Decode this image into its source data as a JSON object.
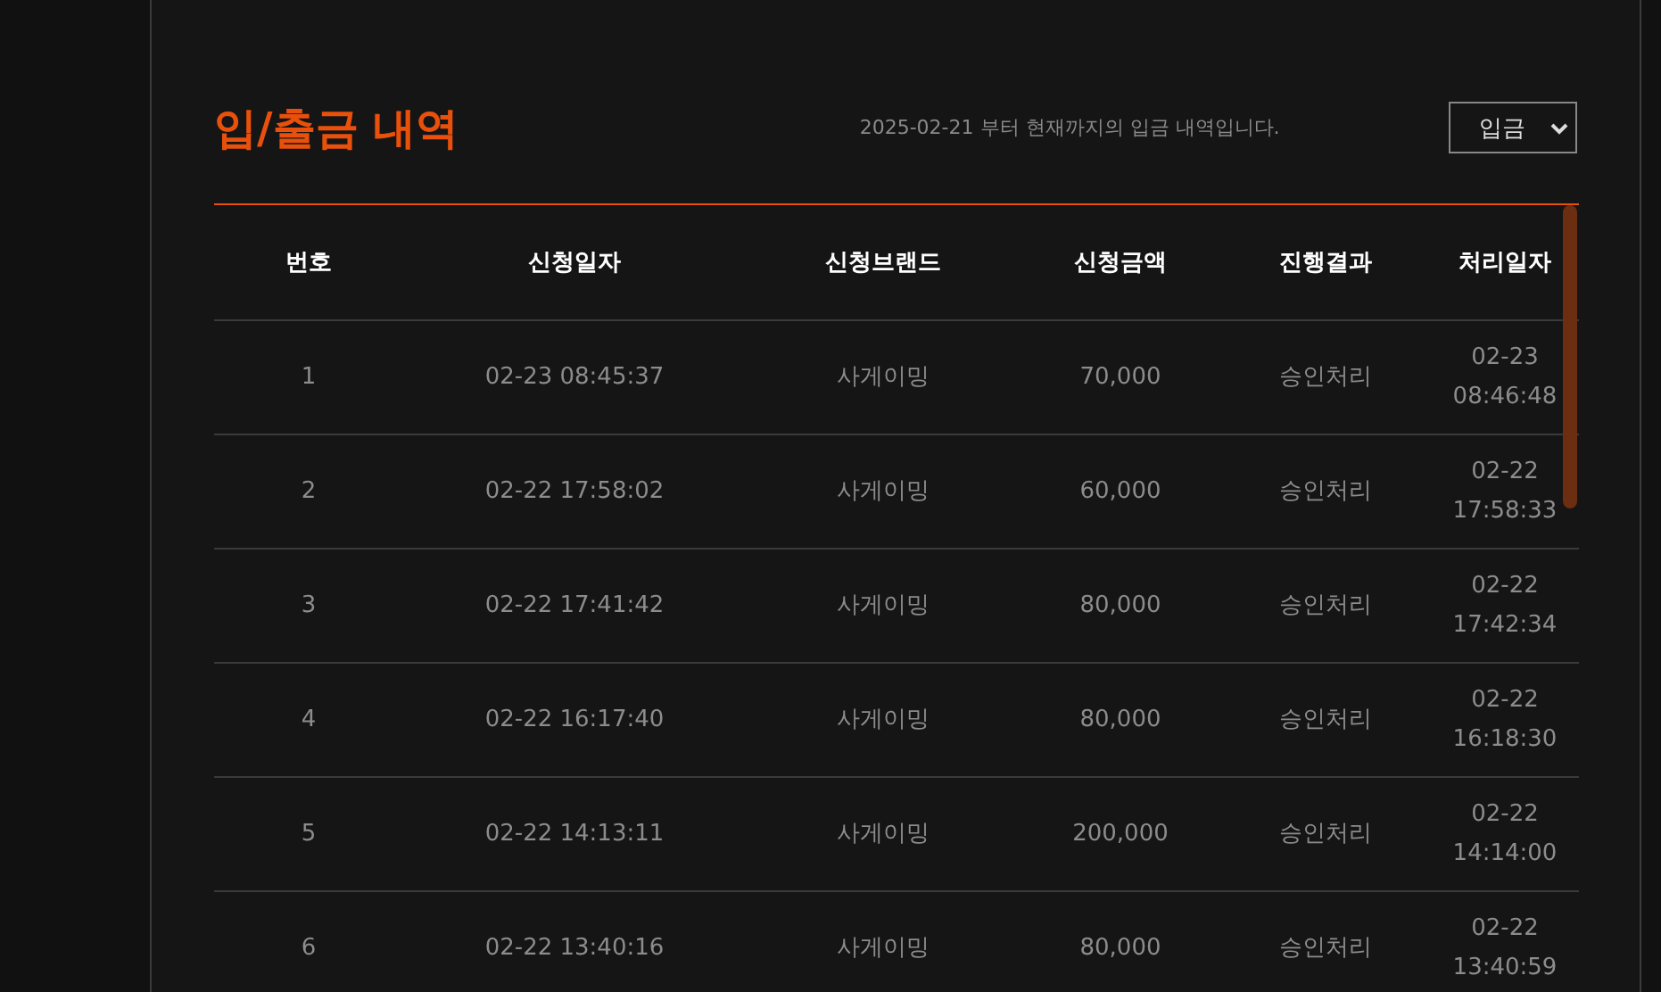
{
  "title": "입/출금 내역",
  "notice": "2025-02-21 부터 현재까지의 입금 내역입니다.",
  "filter": {
    "value": "입금"
  },
  "table": {
    "columns": [
      "번호",
      "신청일자",
      "신청브랜드",
      "신청금액",
      "진행결과",
      "처리일자"
    ],
    "rows": [
      [
        "1",
        "02-23 08:45:37",
        "사게이밍",
        "70,000",
        "승인처리",
        "02-23 08:46:48"
      ],
      [
        "2",
        "02-22 17:58:02",
        "사게이밍",
        "60,000",
        "승인처리",
        "02-22 17:58:33"
      ],
      [
        "3",
        "02-22 17:41:42",
        "사게이밍",
        "80,000",
        "승인처리",
        "02-22 17:42:34"
      ],
      [
        "4",
        "02-22 16:17:40",
        "사게이밍",
        "80,000",
        "승인처리",
        "02-22 16:18:30"
      ],
      [
        "5",
        "02-22 14:13:11",
        "사게이밍",
        "200,000",
        "승인처리",
        "02-22 14:14:00"
      ],
      [
        "6",
        "02-22 13:40:16",
        "사게이밍",
        "80,000",
        "승인처리",
        "02-22 13:40:59"
      ]
    ]
  }
}
